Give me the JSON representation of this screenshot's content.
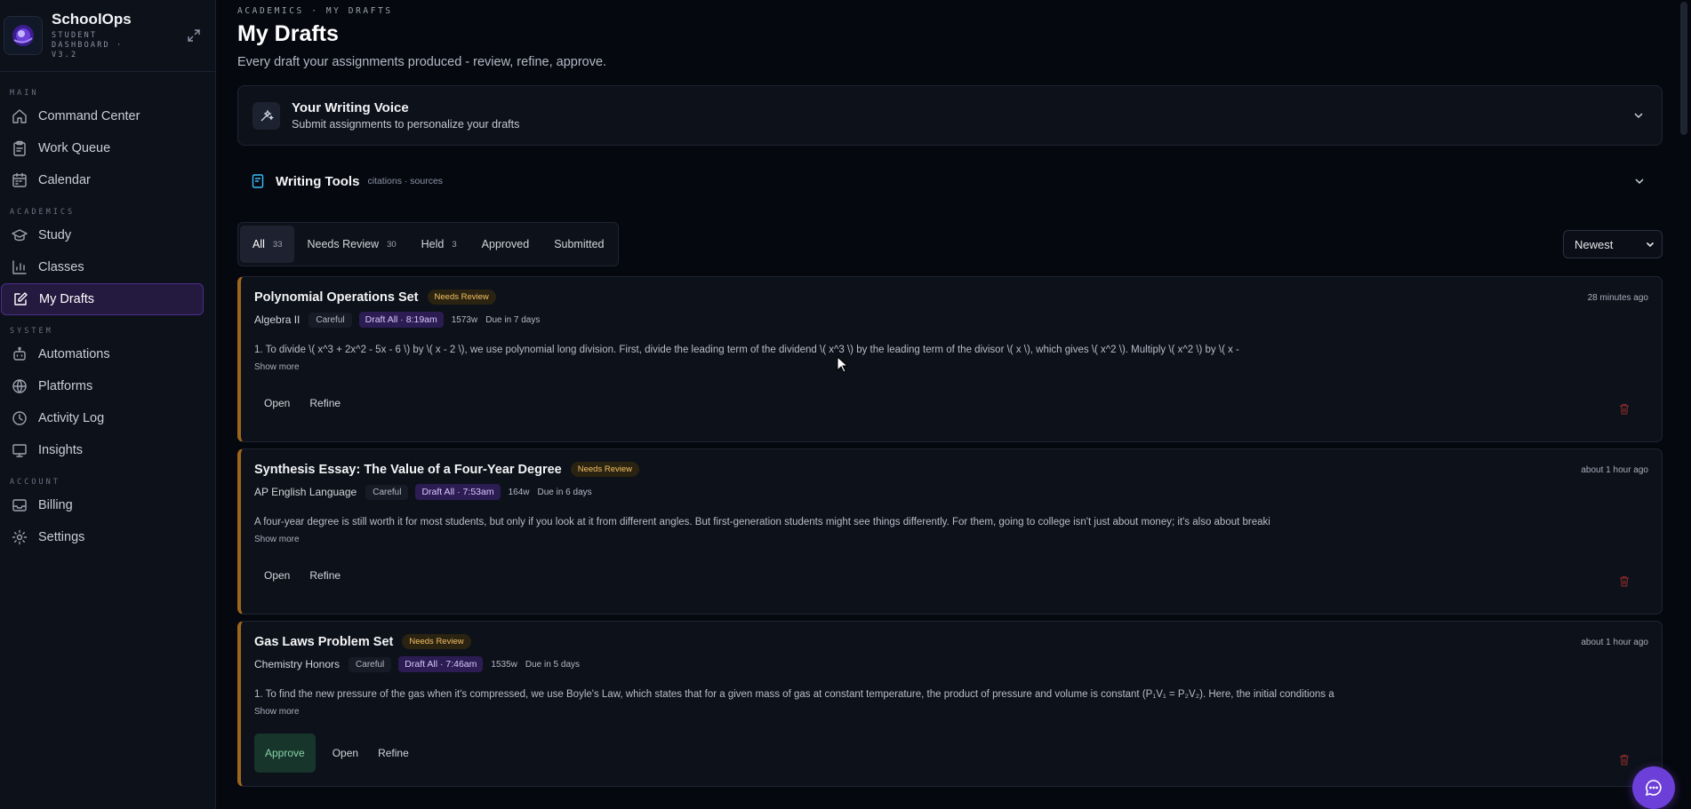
{
  "brand": {
    "name": "SchoolOps",
    "subtitle": "Student Dashboard · v3.2"
  },
  "sidebar": {
    "sections": [
      {
        "label": "Main",
        "items": [
          {
            "label": "Command Center",
            "icon": "home-icon"
          },
          {
            "label": "Work Queue",
            "icon": "clipboard-icon"
          },
          {
            "label": "Calendar",
            "icon": "calendar-icon"
          }
        ]
      },
      {
        "label": "Academics",
        "items": [
          {
            "label": "Study",
            "icon": "graduation-cap-icon"
          },
          {
            "label": "Classes",
            "icon": "bar-chart-icon"
          },
          {
            "label": "My Drafts",
            "icon": "edit-icon",
            "active": true
          }
        ]
      },
      {
        "label": "System",
        "items": [
          {
            "label": "Automations",
            "icon": "bot-icon"
          },
          {
            "label": "Platforms",
            "icon": "globe-icon"
          },
          {
            "label": "Activity Log",
            "icon": "clock-icon"
          },
          {
            "label": "Insights",
            "icon": "presentation-icon"
          }
        ]
      },
      {
        "label": "Account",
        "items": [
          {
            "label": "Billing",
            "icon": "inbox-icon"
          },
          {
            "label": "Settings",
            "icon": "gear-icon"
          }
        ]
      }
    ]
  },
  "header": {
    "breadcrumb": "Academics · My Drafts",
    "title": "My Drafts",
    "subtitle": "Every draft your assignments produced - review, refine, approve."
  },
  "voice": {
    "title": "Your Writing Voice",
    "subtitle": "Submit assignments to personalize your drafts"
  },
  "tools": {
    "title": "Writing Tools",
    "subtitle": "citations · sources"
  },
  "filters": {
    "tabs": [
      {
        "label": "All",
        "count": "33",
        "active": true
      },
      {
        "label": "Needs Review",
        "count": "30"
      },
      {
        "label": "Held",
        "count": "3"
      },
      {
        "label": "Approved",
        "count": ""
      },
      {
        "label": "Submitted",
        "count": ""
      }
    ],
    "sort": "Newest"
  },
  "cards": [
    {
      "title": "Polynomial Operations Set",
      "status": "Needs Review",
      "time": "28 minutes ago",
      "course": "Algebra II",
      "mode": "Careful",
      "auto": "Draft All · 8:19am",
      "words": "1573w",
      "due": "Due in 7 days",
      "excerpt": "1. To divide \\( x^3 + 2x^2 - 5x - 6 \\) by \\( x - 2 \\), we use polynomial long division. First, divide the leading term of the dividend \\( x^3 \\) by the leading term of the divisor \\( x \\), which gives \\( x^2 \\). Multiply \\( x^2 \\) by \\( x -",
      "show_more": "Show more",
      "actions": [
        "Open",
        "Refine"
      ],
      "approve": false
    },
    {
      "title": "Synthesis Essay: The Value of a Four-Year Degree",
      "status": "Needs Review",
      "time": "about 1 hour ago",
      "course": "AP English Language",
      "mode": "Careful",
      "auto": "Draft All · 7:53am",
      "words": "164w",
      "due": "Due in 6 days",
      "excerpt": "A four-year degree is still worth it for most students, but only if you look at it from different angles. But first-generation students might see things differently. For them, going to college isn't just about money; it's also about breaki",
      "show_more": "Show more",
      "actions": [
        "Open",
        "Refine"
      ],
      "approve": false
    },
    {
      "title": "Gas Laws Problem Set",
      "status": "Needs Review",
      "time": "about 1 hour ago",
      "course": "Chemistry Honors",
      "mode": "Careful",
      "auto": "Draft All · 7:46am",
      "words": "1535w",
      "due": "Due in 5 days",
      "excerpt": "1. To find the new pressure of the gas when it's compressed, we use Boyle's Law, which states that for a given mass of gas at constant temperature, the product of pressure and volume is constant (P₁V₁ = P₂V₂). Here, the initial conditions a",
      "show_more": "Show more",
      "actions": [
        "Open",
        "Refine"
      ],
      "approve": true,
      "approve_label": "Approve"
    }
  ],
  "colors": {
    "accent": "#6d3fd9",
    "needs_review_border": "#a0651c",
    "active_nav_bg": "#24193f"
  }
}
